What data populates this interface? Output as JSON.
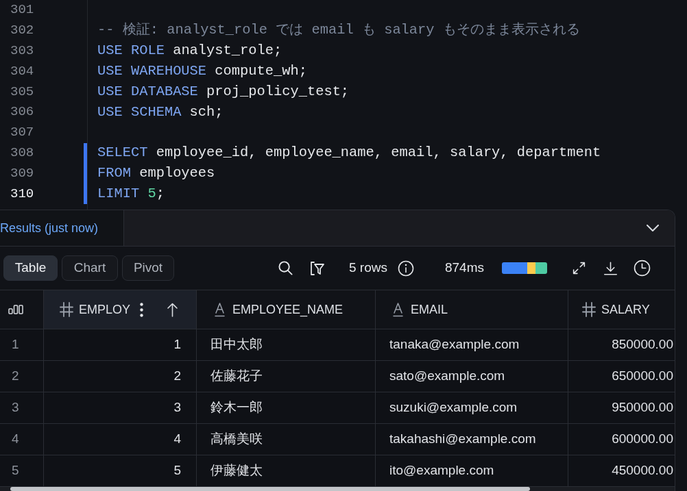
{
  "editor": {
    "lines": [
      {
        "number": "301",
        "active": false,
        "highlighted": false
      },
      {
        "number": "302",
        "active": false,
        "highlighted": false,
        "tokens": [
          {
            "kind": "comment",
            "text": "-- 検証: analyst_role では email も salary もそのまま表示される"
          }
        ]
      },
      {
        "number": "303",
        "active": false,
        "highlighted": false,
        "tokens": [
          {
            "kind": "keyword",
            "text": "USE ROLE"
          },
          {
            "kind": "plain",
            "text": " analyst_role;"
          }
        ]
      },
      {
        "number": "304",
        "active": false,
        "highlighted": false,
        "tokens": [
          {
            "kind": "keyword",
            "text": "USE WAREHOUSE"
          },
          {
            "kind": "plain",
            "text": " compute_wh;"
          }
        ]
      },
      {
        "number": "305",
        "active": false,
        "highlighted": false,
        "tokens": [
          {
            "kind": "keyword",
            "text": "USE DATABASE"
          },
          {
            "kind": "plain",
            "text": " proj_policy_test;"
          }
        ]
      },
      {
        "number": "306",
        "active": false,
        "highlighted": false,
        "tokens": [
          {
            "kind": "keyword",
            "text": "USE SCHEMA"
          },
          {
            "kind": "plain",
            "text": " sch;"
          }
        ]
      },
      {
        "number": "307",
        "active": false,
        "highlighted": false
      },
      {
        "number": "308",
        "active": false,
        "highlighted": true,
        "tokens": [
          {
            "kind": "keyword",
            "text": "SELECT"
          },
          {
            "kind": "plain",
            "text": " employee_id, employee_name, email, salary, department"
          }
        ]
      },
      {
        "number": "309",
        "active": false,
        "highlighted": true,
        "tokens": [
          {
            "kind": "keyword",
            "text": "FROM"
          },
          {
            "kind": "plain",
            "text": " employees"
          }
        ]
      },
      {
        "number": "310",
        "active": true,
        "highlighted": true,
        "tokens": [
          {
            "kind": "keyword",
            "text": "LIMIT"
          },
          {
            "kind": "number",
            "text": " 5"
          },
          {
            "kind": "plain",
            "text": ";"
          }
        ]
      }
    ]
  },
  "results": {
    "tab": {
      "label": "Results (just now)",
      "selected": true
    },
    "view_tabs": [
      {
        "label": "Table",
        "selected": true
      },
      {
        "label": "Chart",
        "selected": false
      },
      {
        "label": "Pivot",
        "selected": false
      }
    ],
    "row_count": "5 rows",
    "duration": "874ms",
    "table": {
      "columns": [
        {
          "label": "EMPLOY",
          "kind": "number",
          "selected": true,
          "sorted": true
        },
        {
          "label": "EMPLOYEE_NAME",
          "kind": "text",
          "selected": false,
          "sorted": false
        },
        {
          "label": "EMAIL",
          "kind": "text",
          "selected": false,
          "sorted": false
        },
        {
          "label": "SALARY",
          "kind": "number",
          "selected": false,
          "sorted": false
        }
      ],
      "rows": [
        {
          "index": "1",
          "cells": [
            "1",
            "田中太郎",
            "tanaka@example.com",
            "850000.00"
          ]
        },
        {
          "index": "2",
          "cells": [
            "2",
            "佐藤花子",
            "sato@example.com",
            "650000.00"
          ]
        },
        {
          "index": "3",
          "cells": [
            "3",
            "鈴木一郎",
            "suzuki@example.com",
            "950000.00"
          ]
        },
        {
          "index": "4",
          "cells": [
            "4",
            "高橋美咲",
            "takahashi@example.com",
            "600000.00"
          ]
        },
        {
          "index": "5",
          "cells": [
            "5",
            "伊藤健太",
            "ito@example.com",
            "450000.00"
          ]
        }
      ]
    }
  }
}
